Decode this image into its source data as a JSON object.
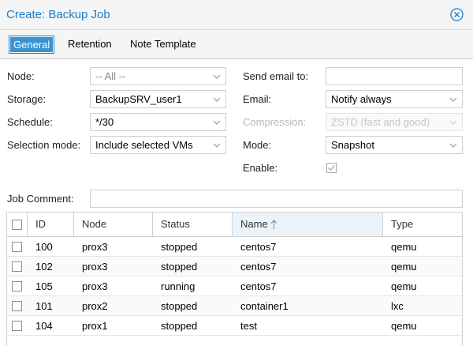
{
  "window": {
    "title": "Create: Backup Job",
    "close_icon": "close-circle-icon"
  },
  "tabs": [
    {
      "label": "General",
      "active": true
    },
    {
      "label": "Retention",
      "active": false
    },
    {
      "label": "Note Template",
      "active": false
    }
  ],
  "form": {
    "node": {
      "label": "Node:",
      "value": "-- All --"
    },
    "storage": {
      "label": "Storage:",
      "value": "BackupSRV_user1"
    },
    "schedule": {
      "label": "Schedule:",
      "value": "*/30"
    },
    "selection_mode": {
      "label": "Selection mode:",
      "value": "Include selected VMs"
    },
    "send_email": {
      "label": "Send email to:",
      "value": ""
    },
    "email": {
      "label": "Email:",
      "value": "Notify always"
    },
    "compression": {
      "label": "Compression:",
      "value": "ZSTD (fast and good)",
      "disabled": true
    },
    "mode": {
      "label": "Mode:",
      "value": "Snapshot"
    },
    "enable": {
      "label": "Enable:",
      "checked": true
    },
    "job_comment": {
      "label": "Job Comment:",
      "value": ""
    }
  },
  "grid": {
    "columns": [
      "ID",
      "Node",
      "Status",
      "Name",
      "Type"
    ],
    "sort": {
      "column": "Name",
      "direction": "ascending",
      "icon": "arrow-up-icon"
    },
    "rows": [
      {
        "id": "100",
        "node": "prox3",
        "status": "stopped",
        "name": "centos7",
        "type": "qemu"
      },
      {
        "id": "102",
        "node": "prox3",
        "status": "stopped",
        "name": "centos7",
        "type": "qemu"
      },
      {
        "id": "105",
        "node": "prox3",
        "status": "running",
        "name": "centos7",
        "type": "qemu"
      },
      {
        "id": "101",
        "node": "prox2",
        "status": "stopped",
        "name": "container1",
        "type": "lxc"
      },
      {
        "id": "104",
        "node": "prox1",
        "status": "stopped",
        "name": "test",
        "type": "qemu"
      }
    ]
  },
  "colors": {
    "accent": "#157fcc",
    "tab_active_bg": "#3892d4",
    "header_bg": "#f5f5f5"
  }
}
